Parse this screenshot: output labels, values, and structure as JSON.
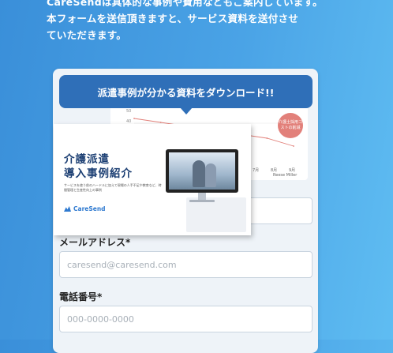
{
  "intro": {
    "line1": "CareSendは具体的な事例や費用などもご案内しています。",
    "line2": "本フォームを送信頂きますと、サービス資料を送付させ",
    "line3": "ていただきます。"
  },
  "banner": {
    "text": "派遣事例が分かる資料をダウンロード!!"
  },
  "booklet": {
    "title_line1": "介護派遣",
    "title_line2": "導入事例紹介",
    "description": "サービスを使う前のハードルに加えて現場の人手不足や教育など、時間管理と生産性向上の事例",
    "logo": "CareSend"
  },
  "chart": {
    "badge": "介護士採用コストの削減",
    "legend": "Reese Miller"
  },
  "chart_data": {
    "type": "line",
    "x": [
      "",
      "",
      "",
      "",
      "7月",
      "8月",
      "9月"
    ],
    "series": [
      {
        "name": "Reese Miller",
        "values": [
          48,
          47,
          46,
          45,
          44,
          43,
          41
        ]
      }
    ],
    "ylim": [
      38,
      50
    ],
    "yticks": [
      "50",
      "40"
    ],
    "color": "#e2807a"
  },
  "form": {
    "email_label": "メールアドレス*",
    "email_placeholder": "caresend@caresend.com",
    "phone_label": "電話番号*",
    "phone_placeholder": "000-0000-0000"
  },
  "colors": {
    "accent": "#2f6fb8",
    "background": "#4aa3e6"
  }
}
